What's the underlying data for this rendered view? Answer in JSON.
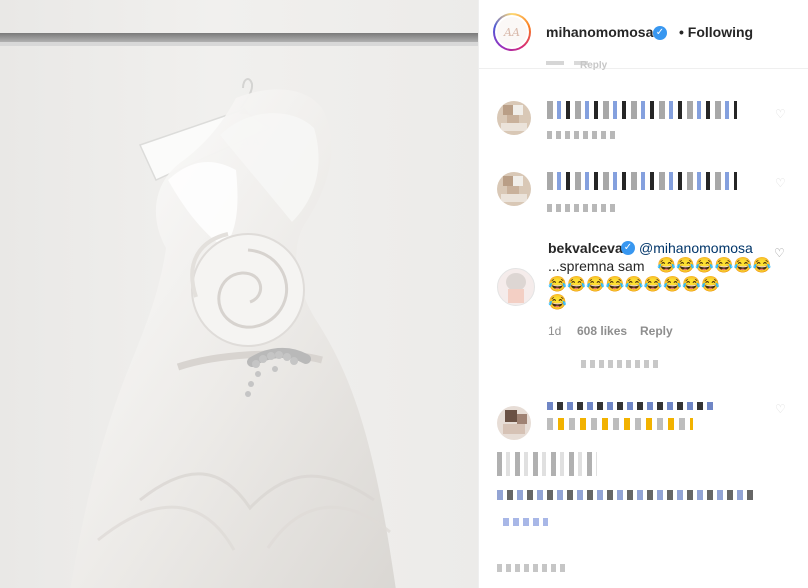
{
  "account": {
    "username": "mihanomomosa",
    "status": "• Following",
    "avatar_text": "AA"
  },
  "comments": [
    {
      "author": "",
      "blurred": true
    },
    {
      "author": "",
      "blurred": true
    },
    {
      "author": "bekvalceva",
      "mention": "@mihanomomosa",
      "text": "...spremna sam",
      "emoji_line1": "😂😂😂😂😂😂",
      "emoji_line2": "😂😂😂😂😂😂😂😂😂",
      "emoji_line3": "😂",
      "age": "1d",
      "likes": "608 likes",
      "reply": "Reply"
    }
  ],
  "top_reply": "Reply",
  "colors": {
    "verified": "#3897f0",
    "emoji": "#f2b200",
    "border": "#efefef"
  }
}
